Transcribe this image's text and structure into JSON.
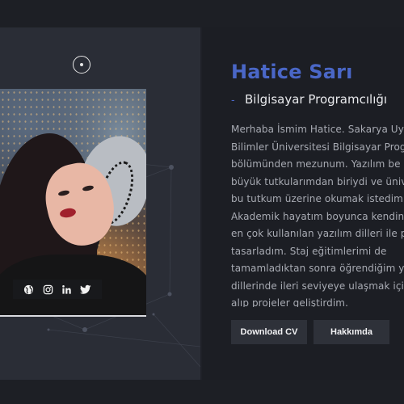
{
  "profile": {
    "name": "Hatice Sarı",
    "role_dash": "-",
    "role": "Bilgisayar Programcılığı",
    "bio_lines": [
      "Merhaba İsmim Hatice. Sakarya Uyg",
      "Bilimler Üniversitesi Bilgisayar Prog",
      "bölümünden mezunum. Yazılım be",
      "büyük tutkularımdan biriydi ve üniv",
      "bu tutkum üzerine okumak istedim",
      "Akademik hayatım boyunca kendin",
      "en çok kullanılan yazılım dilleri ile p",
      "tasarladım. Staj eğitimlerimi de",
      "tamamladıktan sonra öğrendiğim y",
      "dillerinde ileri seviyeye ulaşmak için",
      "alıp projeler geliştirdim."
    ]
  },
  "buttons": {
    "download_cv": "Download CV",
    "about": "Hakkımda"
  },
  "social": [
    {
      "icon": "globe-icon"
    },
    {
      "icon": "instagram-icon"
    },
    {
      "icon": "linkedin-icon"
    },
    {
      "icon": "twitter-icon"
    }
  ],
  "colors": {
    "accent": "#4a67c7",
    "page_bg": "#1f2128",
    "left_panel": "#2a2d36",
    "right_panel": "#1c1e24",
    "button_bg": "#2e3139"
  }
}
